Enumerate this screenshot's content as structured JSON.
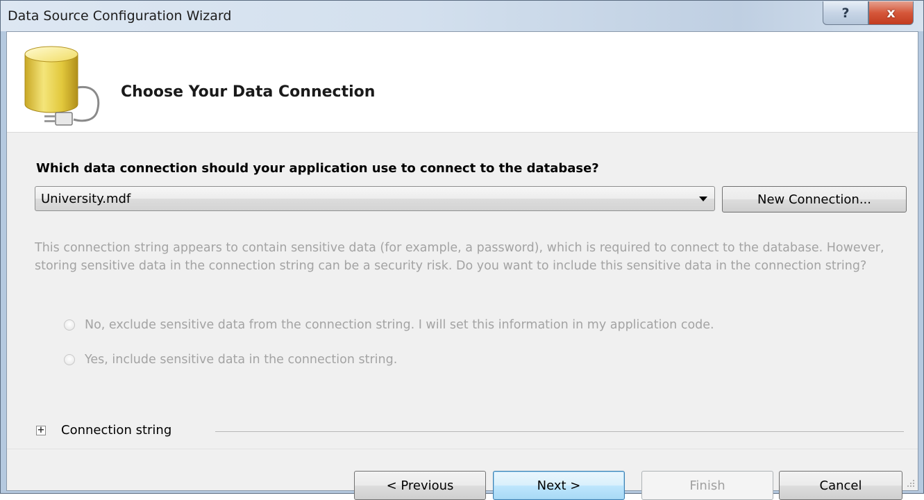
{
  "window": {
    "title": "Data Source Configuration Wizard"
  },
  "titlebar_buttons": {
    "help": "?",
    "close": "x"
  },
  "header": {
    "title": "Choose Your Data Connection",
    "icon": "database-plug-icon"
  },
  "connection": {
    "question": "Which data connection should your application use to connect to the database?",
    "selected": "University.mdf",
    "new_connection_label": "New Connection..."
  },
  "sensitive": {
    "notice": "This connection string appears to contain sensitive data (for example, a password), which is required to connect to the database. However, storing sensitive data in the connection string can be a security risk. Do you want to include this sensitive data in the connection string?",
    "option_no": "No, exclude sensitive data from the connection string. I will set this information in my application code.",
    "option_yes": "Yes, include sensitive data in the connection string."
  },
  "connection_string": {
    "label": "Connection string",
    "expander": "+"
  },
  "footer": {
    "previous_label": "< Previous",
    "next_label": "Next >",
    "finish_label": "Finish",
    "cancel_label": "Cancel"
  },
  "colors": {
    "disabled_text": "#a3a3a3",
    "default_button_border": "#3c7fb1",
    "close_button": "#c23b1f"
  }
}
